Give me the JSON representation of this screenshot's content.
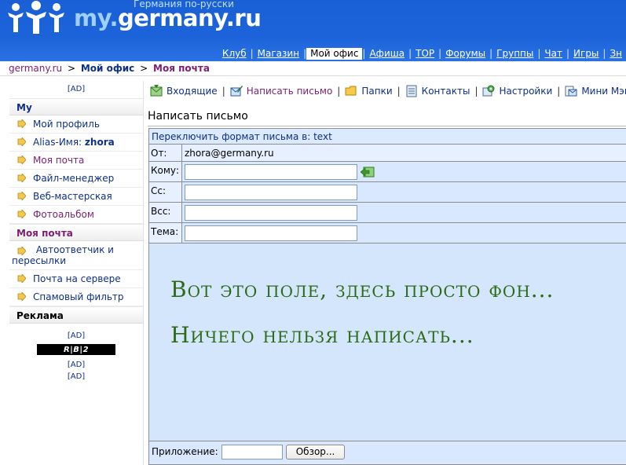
{
  "header": {
    "logo_prefix": "my.",
    "logo_name": "germany.ru",
    "tagline": "Германия по-русски",
    "nav": [
      {
        "label": "Клуб"
      },
      {
        "label": "Магазин"
      },
      {
        "label": "Мой офис",
        "active": true
      },
      {
        "label": "Афиша"
      },
      {
        "label": "TOP"
      },
      {
        "label": "Форумы"
      },
      {
        "label": "Группы"
      },
      {
        "label": "Чат"
      },
      {
        "label": "Игры"
      },
      {
        "label": "Зн"
      }
    ]
  },
  "breadcrumb": {
    "home": "germany.ru",
    "sep": ">",
    "level1": "Мой офис",
    "level2": "Моя почта"
  },
  "sidebar": {
    "ad_label": "[AD]",
    "section_my": "My",
    "my_items": [
      {
        "label": "Мой профиль"
      },
      {
        "label": "Alias-Имя: ",
        "bold": "zhora"
      },
      {
        "label": "Моя почта"
      },
      {
        "label": "Файл-менеджер"
      },
      {
        "label": "Веб-мастерская"
      },
      {
        "label": "Фотоальбом"
      }
    ],
    "section_mail": "Моя почта",
    "mail_items": [
      {
        "label": "Автоответчик и пересылки"
      },
      {
        "label": "Почта на сервере"
      },
      {
        "label": "Спамовый фильтр"
      }
    ],
    "section_ads": "Реклама",
    "ads": [
      "[AD]",
      "[AD]",
      "[AD]"
    ],
    "banner_text": "R|B|2"
  },
  "toolbar": {
    "items": [
      {
        "label": "Входящие",
        "icon": "inbox-icon"
      },
      {
        "label": "Написать письмо",
        "icon": "compose-icon"
      },
      {
        "label": "Папки",
        "icon": "folder-icon"
      },
      {
        "label": "Контакты",
        "icon": "contacts-icon"
      },
      {
        "label": "Настройки",
        "icon": "settings-icon"
      },
      {
        "label": "Мини Мэйл",
        "icon": "mini-mail-icon"
      }
    ]
  },
  "compose": {
    "title": "Написать письмо",
    "format_switch": "Переключить формат письма в: text",
    "from_label": "От:",
    "from_value": "zhora@germany.ru",
    "to_label": "Кому:",
    "to_value": "",
    "cc_label": "Cc:",
    "cc_value": "",
    "bcc_label": "Bcc:",
    "bcc_value": "",
    "subject_label": "Тема:",
    "subject_value": "",
    "body_line1": "Вот это поле, здесь просто фон...",
    "body_line2": "Ничего нельзя написать...",
    "attach_label": "Приложение:",
    "browse_button": "Обзор..."
  },
  "colors": {
    "header_blue": "#1c63da",
    "link_blue": "#0d2f86",
    "link_purple": "#7a1f6f",
    "form_bg": "#dbeaff",
    "body_text_green": "#2d6a17"
  }
}
